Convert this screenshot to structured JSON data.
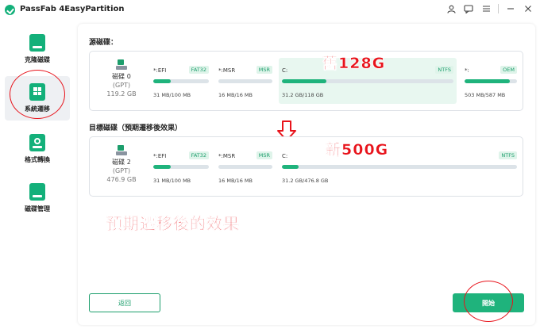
{
  "app": {
    "title": "PassFab 4EasyPartition"
  },
  "sidebar": {
    "items": [
      {
        "label": "克隆磁碟",
        "icon": "clone-disk-icon"
      },
      {
        "label": "系統遷移",
        "icon": "system-migration-icon"
      },
      {
        "label": "格式轉換",
        "icon": "format-convert-icon"
      },
      {
        "label": "磁碟管理",
        "icon": "disk-manage-icon"
      }
    ],
    "active_index": 1
  },
  "source": {
    "section_label": "源磁碟：",
    "disk": {
      "name": "磁碟 0",
      "type": "(GPT)",
      "size": "119.2 GB"
    },
    "partitions": [
      {
        "name": "*:EFI",
        "fs": "FAT32",
        "size": "31 MB/100 MB",
        "fill": 0.31
      },
      {
        "name": "*:MSR",
        "fs": "MSR",
        "size": "16 MB/16 MB",
        "fill": 0
      },
      {
        "name": "C:",
        "fs": "NTFS",
        "size": "31.2 GB/118 GB",
        "fill": 0.26,
        "highlight": true
      },
      {
        "name": "*:",
        "fs": "OEM",
        "size": "503 MB/587 MB",
        "fill": 0.86
      }
    ]
  },
  "target": {
    "section_label": "目標磁碟（預期遷移後效果）",
    "disk": {
      "name": "磁碟 2",
      "type": "(GPT)",
      "size": "476.9 GB"
    },
    "partitions": [
      {
        "name": "*:EFI",
        "fs": "FAT32",
        "size": "31 MB/100 MB",
        "fill": 0.31
      },
      {
        "name": "*:MSR",
        "fs": "MSR",
        "size": "16 MB/16 MB",
        "fill": 0
      },
      {
        "name": "C:",
        "fs": "NTFS",
        "size": "31.2 GB/476.8 GB",
        "fill": 0.07
      }
    ]
  },
  "annotations": {
    "old": "舊128G",
    "new": "新500G",
    "note": "預期遷移後的效果",
    "color": "#e8131b"
  },
  "buttons": {
    "back": "返回",
    "start": "開始"
  },
  "colors": {
    "accent": "#1fb37c",
    "track": "#dce3e8"
  }
}
